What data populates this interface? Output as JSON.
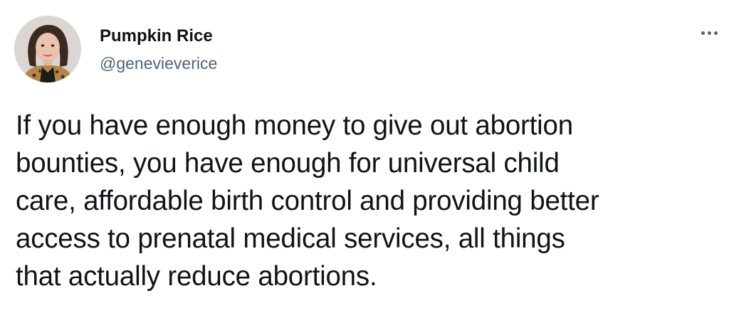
{
  "tweet": {
    "author": {
      "display_name": "Pumpkin Rice",
      "handle": "@genevieverice"
    },
    "icons": {
      "avatar": "profile-photo",
      "more": "more-horizontal-icon"
    },
    "text_lines": [
      "If you have enough money to give out abortion",
      "bounties, you have enough for universal child",
      "care, affordable birth control and providing better",
      "access to prenatal medical services, all things",
      "that actually reduce abortions."
    ]
  }
}
